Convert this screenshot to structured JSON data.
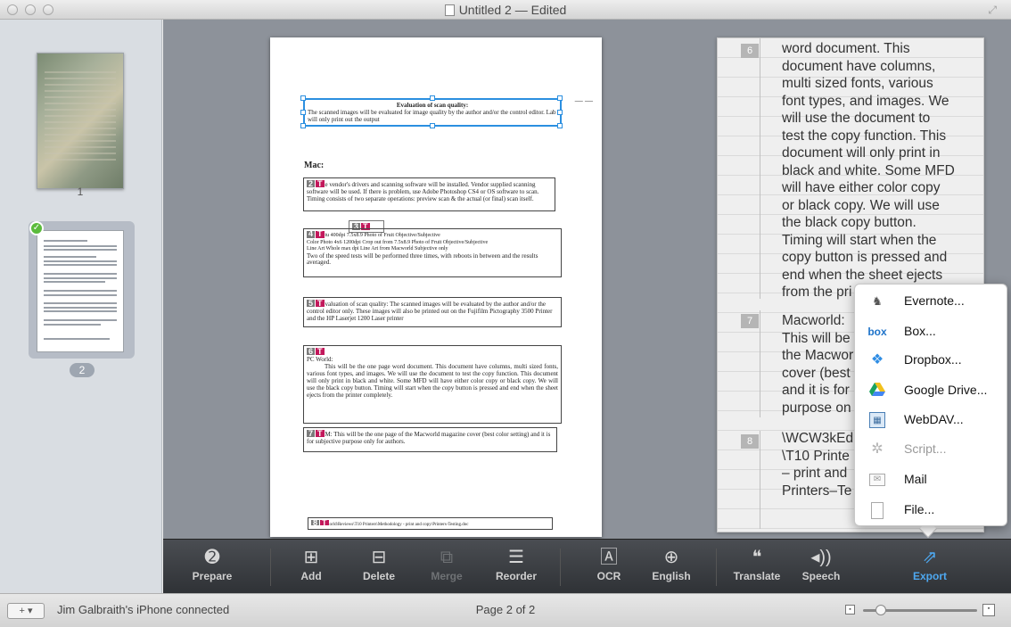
{
  "window": {
    "title": "Untitled 2 — Edited"
  },
  "sidebar": {
    "pages": [
      {
        "number": "1"
      },
      {
        "number": "2",
        "selected": true
      }
    ]
  },
  "document": {
    "blocks": {
      "b1_title": "Evaluation of scan quality:",
      "b1_text": "The scanned images will be evaluated for image quality by the author and/or the control editor. Lab will only print out the output",
      "mac_heading": "Mac:",
      "b2_tag": "2",
      "b2_tag_t": "T",
      "b2_text": "e vendor's drivers and scanning software will be installed. Vendor supplied scanning software will be used. If there is problem, use Adobe Photoshop CS4 or OS software to scan. Timing consists of two separate operations: preview scan & the actual (or final) scan itself.",
      "b3_tag": "3",
      "b4_tag": "4",
      "b4_row1": "tu   400dpi   7.5x8.9 Photo of Fruit   Objective/Subjective",
      "b4_row2": "Color Photo   4x6   1200dpi   Crop out from 7.5x8.9 Photo of Fruit   Objective/Subjective",
      "b4_row3": "Line Art   Whole   max dpi   Line Art from Macworld   Subjective only",
      "b4_text": "Two of the speed tests will be performed three times, with reboots in between and the results averaged.",
      "b5_tag": "5",
      "b5_text": "valuation of scan quality: The scanned images will be evaluated by the author and/or the control editor only. These images will also be printed out on the Fujifilm Pictography 3500 Printer and the HP Laserjet 1200 Laser printer",
      "b6_tag": "6",
      "b6_head": "PC World:",
      "b6_text": "This will be the one page word document. This document have columns, multi sized fonts, various font types, and images. We will use the document to test the copy function. This document will only print in black and white. Some MFD will have either color copy or black copy. We will use the black copy button. Timing will start when the copy button is pressed and end when the sheet ejects from the printer completely.",
      "b7_tag": "7",
      "b7_text": "M: This will be the one page of the Macworld magazine cover (best color setting) and it is for subjective purpose only for authors.",
      "b8_tag": "8",
      "b8_text": "orld\\Reviews\\T10 Printers\\Methodology - print and copy\\Printers-Testing.doc",
      "dash": "— —"
    }
  },
  "text_panel": {
    "items": [
      {
        "num": "6",
        "text": "word document. This\ndocument have columns,\nmulti sized fonts, various\nfont types, and images. We\nwill use the document to\ntest the copy function. This\ndocument will only print in\nblack and white. Some MFD\nwill have either color copy\nor black copy. We will use\nthe black copy button.\nTiming will start when the\ncopy button is pressed and\nend when the sheet ejects\nfrom the pri"
      },
      {
        "num": "7",
        "text": "Macworld:\nThis will be\nthe Macwor\ncover (best\nand it is for\npurpose on"
      },
      {
        "num": "8",
        "text": "\\WCW3kEdi\n\\T10 Printe\n– print and\nPrinters–Te"
      }
    ]
  },
  "export_menu": {
    "items": [
      {
        "label": "Evernote...",
        "icon": "evernote-icon",
        "enabled": true
      },
      {
        "label": "Box...",
        "icon": "box-icon",
        "enabled": true
      },
      {
        "label": "Dropbox...",
        "icon": "dropbox-icon",
        "enabled": true
      },
      {
        "label": "Google Drive...",
        "icon": "google-drive-icon",
        "enabled": true
      },
      {
        "label": "WebDAV...",
        "icon": "webdav-icon",
        "enabled": true
      },
      {
        "label": "Script...",
        "icon": "gear-icon",
        "enabled": false
      },
      {
        "label": "Mail",
        "icon": "mail-icon",
        "enabled": true
      },
      {
        "label": "File...",
        "icon": "file-icon",
        "enabled": true
      }
    ]
  },
  "toolbar": {
    "prepare": "Prepare",
    "add": "Add",
    "delete": "Delete",
    "merge": "Merge",
    "reorder": "Reorder",
    "ocr": "OCR",
    "english": "English",
    "translate": "Translate",
    "speech": "Speech",
    "export": "Export"
  },
  "status": {
    "device": "Jim Galbraith's iPhone connected",
    "page": "Page 2 of 2"
  },
  "colors": {
    "accent": "#2b8fe0",
    "tag": "#c2185b",
    "export_active": "#4ea8f0"
  }
}
